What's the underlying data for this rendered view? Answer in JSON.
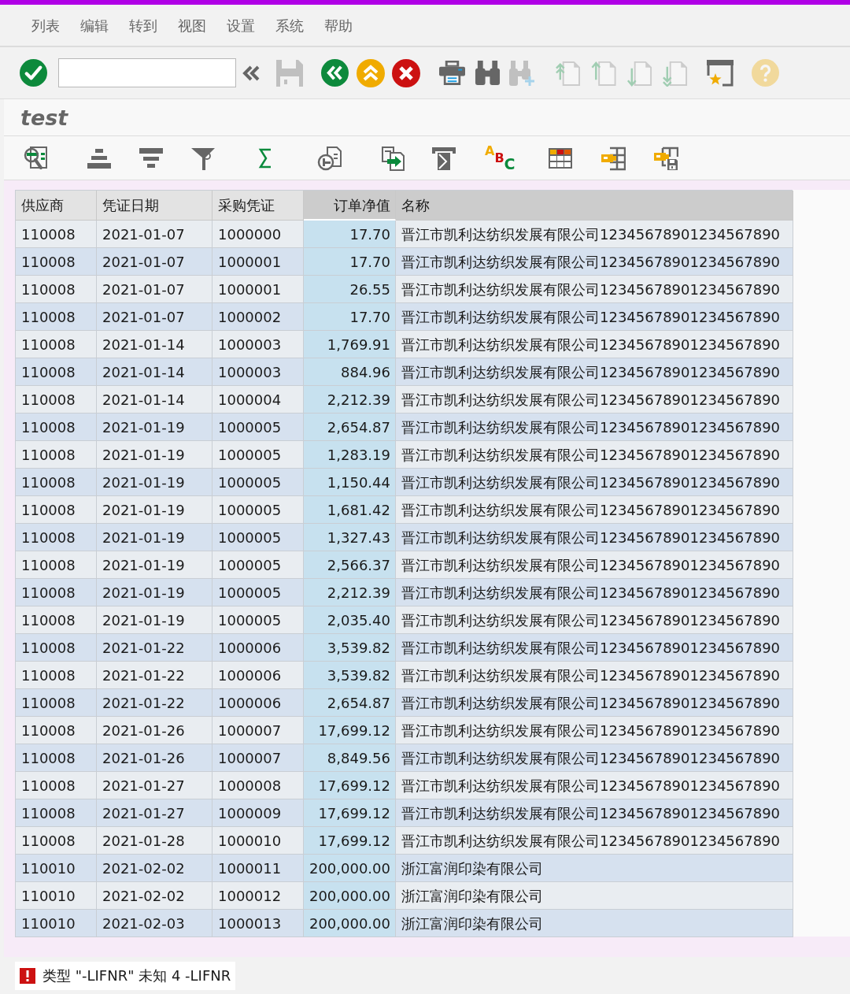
{
  "menu_bar": [
    "列表",
    "编辑",
    "转到",
    "视图",
    "设置",
    "系统",
    "帮助"
  ],
  "toolbar": [
    {
      "kind": "enter",
      "disabled": false
    },
    {
      "kind": "command-field",
      "disabled": false
    },
    {
      "kind": "collapse",
      "disabled": false
    },
    {
      "kind": "save",
      "disabled": true
    },
    {
      "kind": "back",
      "disabled": false
    },
    {
      "kind": "exit",
      "disabled": false
    },
    {
      "kind": "cancel",
      "disabled": false
    },
    {
      "kind": "print",
      "disabled": false
    },
    {
      "kind": "find",
      "disabled": false
    },
    {
      "kind": "find-next",
      "disabled": true
    },
    {
      "kind": "first-page",
      "disabled": true
    },
    {
      "kind": "previous-page",
      "disabled": true
    },
    {
      "kind": "next-page",
      "disabled": true
    },
    {
      "kind": "last-page",
      "disabled": true
    },
    {
      "kind": "bookmark",
      "disabled": false
    },
    {
      "kind": "help",
      "disabled": true
    }
  ],
  "title": "test",
  "alv_toolbar": {
    "abc_letters": [
      "A",
      "B",
      "C"
    ]
  },
  "table": {
    "columns": [
      {
        "label": "供应商",
        "kind": "text",
        "shaded": false,
        "selected": false
      },
      {
        "label": "凭证日期",
        "kind": "text",
        "shaded": false,
        "selected": false
      },
      {
        "label": "采购凭证",
        "kind": "text",
        "shaded": false,
        "selected": false
      },
      {
        "label": "订单净值",
        "kind": "amount",
        "shaded": true,
        "selected": true
      },
      {
        "label": "名称",
        "kind": "text",
        "shaded": true,
        "selected": false
      }
    ],
    "rows": [
      [
        "110008",
        "2021-01-07",
        "1000000",
        "17.70",
        "晋江市凯利达纺织发展有限公司12345678901234567890"
      ],
      [
        "110008",
        "2021-01-07",
        "1000001",
        "17.70",
        "晋江市凯利达纺织发展有限公司12345678901234567890"
      ],
      [
        "110008",
        "2021-01-07",
        "1000001",
        "26.55",
        "晋江市凯利达纺织发展有限公司12345678901234567890"
      ],
      [
        "110008",
        "2021-01-07",
        "1000002",
        "17.70",
        "晋江市凯利达纺织发展有限公司12345678901234567890"
      ],
      [
        "110008",
        "2021-01-14",
        "1000003",
        "1,769.91",
        "晋江市凯利达纺织发展有限公司12345678901234567890"
      ],
      [
        "110008",
        "2021-01-14",
        "1000003",
        "884.96",
        "晋江市凯利达纺织发展有限公司12345678901234567890"
      ],
      [
        "110008",
        "2021-01-14",
        "1000004",
        "2,212.39",
        "晋江市凯利达纺织发展有限公司12345678901234567890"
      ],
      [
        "110008",
        "2021-01-19",
        "1000005",
        "2,654.87",
        "晋江市凯利达纺织发展有限公司12345678901234567890"
      ],
      [
        "110008",
        "2021-01-19",
        "1000005",
        "1,283.19",
        "晋江市凯利达纺织发展有限公司12345678901234567890"
      ],
      [
        "110008",
        "2021-01-19",
        "1000005",
        "1,150.44",
        "晋江市凯利达纺织发展有限公司12345678901234567890"
      ],
      [
        "110008",
        "2021-01-19",
        "1000005",
        "1,681.42",
        "晋江市凯利达纺织发展有限公司12345678901234567890"
      ],
      [
        "110008",
        "2021-01-19",
        "1000005",
        "1,327.43",
        "晋江市凯利达纺织发展有限公司12345678901234567890"
      ],
      [
        "110008",
        "2021-01-19",
        "1000005",
        "2,566.37",
        "晋江市凯利达纺织发展有限公司12345678901234567890"
      ],
      [
        "110008",
        "2021-01-19",
        "1000005",
        "2,212.39",
        "晋江市凯利达纺织发展有限公司12345678901234567890"
      ],
      [
        "110008",
        "2021-01-19",
        "1000005",
        "2,035.40",
        "晋江市凯利达纺织发展有限公司12345678901234567890"
      ],
      [
        "110008",
        "2021-01-22",
        "1000006",
        "3,539.82",
        "晋江市凯利达纺织发展有限公司12345678901234567890"
      ],
      [
        "110008",
        "2021-01-22",
        "1000006",
        "3,539.82",
        "晋江市凯利达纺织发展有限公司12345678901234567890"
      ],
      [
        "110008",
        "2021-01-22",
        "1000006",
        "2,654.87",
        "晋江市凯利达纺织发展有限公司12345678901234567890"
      ],
      [
        "110008",
        "2021-01-26",
        "1000007",
        "17,699.12",
        "晋江市凯利达纺织发展有限公司12345678901234567890"
      ],
      [
        "110008",
        "2021-01-26",
        "1000007",
        "8,849.56",
        "晋江市凯利达纺织发展有限公司12345678901234567890"
      ],
      [
        "110008",
        "2021-01-27",
        "1000008",
        "17,699.12",
        "晋江市凯利达纺织发展有限公司12345678901234567890"
      ],
      [
        "110008",
        "2021-01-27",
        "1000009",
        "17,699.12",
        "晋江市凯利达纺织发展有限公司12345678901234567890"
      ],
      [
        "110008",
        "2021-01-28",
        "1000010",
        "17,699.12",
        "晋江市凯利达纺织发展有限公司12345678901234567890"
      ],
      [
        "110010",
        "2021-02-02",
        "1000011",
        "200,000.00",
        "浙江富润印染有限公司"
      ],
      [
        "110010",
        "2021-02-02",
        "1000012",
        "200,000.00",
        "浙江富润印染有限公司"
      ],
      [
        "110010",
        "2021-02-03",
        "1000013",
        "200,000.00",
        "浙江富润印染有限公司"
      ]
    ]
  },
  "status_bar": {
    "kind": "error",
    "message": "类型 \"-LIFNR\" 未知 4 -LIFNR"
  }
}
